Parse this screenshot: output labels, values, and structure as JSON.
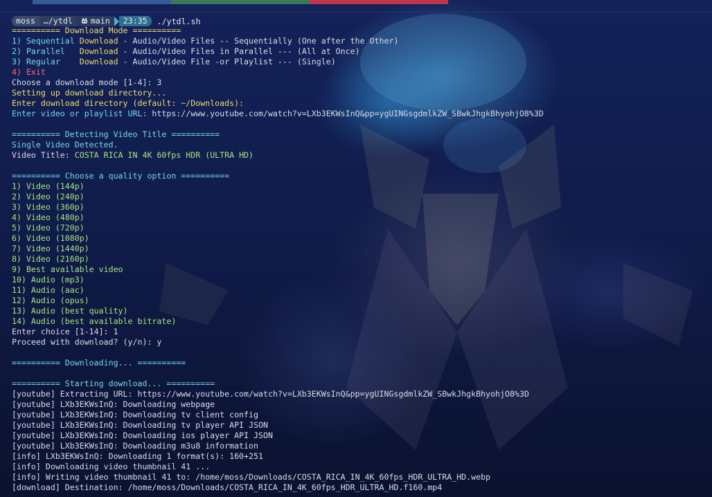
{
  "colors": {
    "bar_blue": "#3a5a9a",
    "bar_green": "#3a7a5a",
    "bar_red": "#c0354a",
    "yellow": "#f2dc6b",
    "cyan": "#74d9e8",
    "green": "#a8e67d",
    "red": "#ff6a6a"
  },
  "prompt": {
    "user": "moss",
    "dir": "…/ytdl",
    "git_icon": "git-branch-icon",
    "branch": "main",
    "time": "23:35",
    "command": "./ytdl.sh"
  },
  "lines": [
    {
      "segs": [
        {
          "t": "========== Download Mode ==========",
          "c": "yellow"
        }
      ]
    },
    {
      "segs": [
        {
          "t": "1) Sequential ",
          "c": "cyan"
        },
        {
          "t": "Download",
          "c": "yellow"
        },
        {
          "t": " - Audio/Video Files -- Sequentially (One after the Other)",
          "c": "white"
        }
      ]
    },
    {
      "segs": [
        {
          "t": "2) Parallel   ",
          "c": "cyan"
        },
        {
          "t": "Download",
          "c": "yellow"
        },
        {
          "t": " - Audio/Video Files in Parallel --- (All at Once)",
          "c": "white"
        }
      ]
    },
    {
      "segs": [
        {
          "t": "3) Regular    ",
          "c": "cyan"
        },
        {
          "t": "Download",
          "c": "yellow"
        },
        {
          "t": " - Audio/Video File -or Playlist --- (Single)",
          "c": "white"
        }
      ]
    },
    {
      "segs": [
        {
          "t": "4) Exit",
          "c": "red"
        }
      ]
    },
    {
      "segs": [
        {
          "t": "Choose a download mode [1-4]: 3",
          "c": "white"
        }
      ]
    },
    {
      "segs": [
        {
          "t": "Setting up download directory...",
          "c": "yellow"
        }
      ]
    },
    {
      "segs": [
        {
          "t": "Enter download directory (default: ~/Downloads):",
          "c": "yellow"
        }
      ]
    },
    {
      "segs": [
        {
          "t": "Enter video or playlist URL: ",
          "c": "cyan"
        },
        {
          "t": "https://www.youtube.com/watch?v=LXb3EKWsInQ&pp=ygUINGsgdmlkZW_SBwkJhgkBhyohjO8%3D",
          "c": "white"
        }
      ]
    },
    {
      "segs": [
        {
          "t": "",
          "c": "white"
        }
      ]
    },
    {
      "segs": [
        {
          "t": "========== Detecting Video Title ==========",
          "c": "cyan"
        }
      ]
    },
    {
      "segs": [
        {
          "t": "Single Video Detected.",
          "c": "cyan"
        }
      ]
    },
    {
      "segs": [
        {
          "t": "Video Title: ",
          "c": "white"
        },
        {
          "t": "COSTA RICA IN 4K 60fps HDR (ULTRA HD)",
          "c": "green"
        }
      ]
    },
    {
      "segs": [
        {
          "t": "",
          "c": "white"
        }
      ]
    },
    {
      "segs": [
        {
          "t": "========== Choose a quality option ==========",
          "c": "cyan"
        }
      ]
    },
    {
      "segs": [
        {
          "t": "1) Video (144p)",
          "c": "green"
        }
      ]
    },
    {
      "segs": [
        {
          "t": "2) Video (240p)",
          "c": "green"
        }
      ]
    },
    {
      "segs": [
        {
          "t": "3) Video (360p)",
          "c": "green"
        }
      ]
    },
    {
      "segs": [
        {
          "t": "4) Video (480p)",
          "c": "green"
        }
      ]
    },
    {
      "segs": [
        {
          "t": "5) Video (720p)",
          "c": "green"
        }
      ]
    },
    {
      "segs": [
        {
          "t": "6) Video (1080p)",
          "c": "green"
        }
      ]
    },
    {
      "segs": [
        {
          "t": "7) Video (1440p)",
          "c": "green"
        }
      ]
    },
    {
      "segs": [
        {
          "t": "8) Video (2160p)",
          "c": "green"
        }
      ]
    },
    {
      "segs": [
        {
          "t": "9) Best available video",
          "c": "green"
        }
      ]
    },
    {
      "segs": [
        {
          "t": "10) Audio (mp3)",
          "c": "green"
        }
      ]
    },
    {
      "segs": [
        {
          "t": "11) Audio (aac)",
          "c": "green"
        }
      ]
    },
    {
      "segs": [
        {
          "t": "12) Audio (opus)",
          "c": "green"
        }
      ]
    },
    {
      "segs": [
        {
          "t": "13) Audio (best quality)",
          "c": "green"
        }
      ]
    },
    {
      "segs": [
        {
          "t": "14) Audio (best available bitrate)",
          "c": "green"
        }
      ]
    },
    {
      "segs": [
        {
          "t": "Enter choice [1-14]: 1",
          "c": "white"
        }
      ]
    },
    {
      "segs": [
        {
          "t": "Proceed with download? (y/n): y",
          "c": "white"
        }
      ]
    },
    {
      "segs": [
        {
          "t": "",
          "c": "white"
        }
      ]
    },
    {
      "segs": [
        {
          "t": "========== Downloading... ==========",
          "c": "cyan"
        }
      ]
    },
    {
      "segs": [
        {
          "t": "",
          "c": "white"
        }
      ]
    },
    {
      "segs": [
        {
          "t": "========== Starting download... ==========",
          "c": "cyan"
        }
      ]
    },
    {
      "segs": [
        {
          "t": "[youtube] Extracting URL: https://www.youtube.com/watch?v=LXb3EKWsInQ&pp=ygUINGsgdmlkZW_SBwkJhgkBhyohjO8%3D",
          "c": "white"
        }
      ]
    },
    {
      "segs": [
        {
          "t": "[youtube] LXb3EKWsInQ: Downloading webpage",
          "c": "white"
        }
      ]
    },
    {
      "segs": [
        {
          "t": "[youtube] LXb3EKWsInQ: Downloading tv client config",
          "c": "white"
        }
      ]
    },
    {
      "segs": [
        {
          "t": "[youtube] LXb3EKWsInQ: Downloading tv player API JSON",
          "c": "white"
        }
      ]
    },
    {
      "segs": [
        {
          "t": "[youtube] LXb3EKWsInQ: Downloading ios player API JSON",
          "c": "white"
        }
      ]
    },
    {
      "segs": [
        {
          "t": "[youtube] LXb3EKWsInQ: Downloading m3u8 information",
          "c": "white"
        }
      ]
    },
    {
      "segs": [
        {
          "t": "[info] LXb3EKWsInQ: Downloading 1 format(s): 160+251",
          "c": "white"
        }
      ]
    },
    {
      "segs": [
        {
          "t": "[info] Downloading video thumbnail 41 ...",
          "c": "white"
        }
      ]
    },
    {
      "segs": [
        {
          "t": "[info] Writing video thumbnail 41 to: /home/moss/Downloads/COSTA_RICA_IN_4K_60fps_HDR_ULTRA_HD.webp",
          "c": "white"
        }
      ]
    },
    {
      "segs": [
        {
          "t": "[download] Destination: /home/moss/Downloads/COSTA_RICA_IN_4K_60fps_HDR_ULTRA_HD.f160.mp4",
          "c": "white"
        }
      ]
    }
  ]
}
